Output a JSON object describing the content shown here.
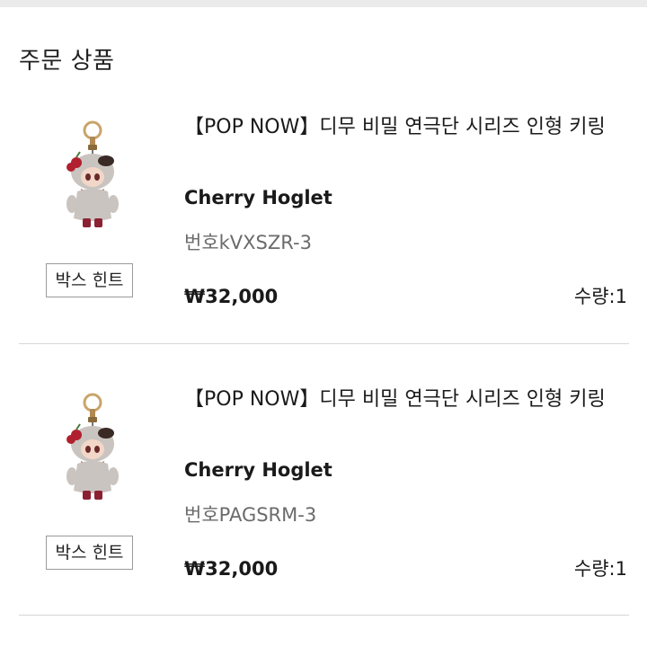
{
  "order": {
    "section_title": "주문 상품",
    "items": [
      {
        "title": "【POP NOW】디무 비밀 연극단 시리즈 인형 키링",
        "option": "Cherry Hoglet",
        "code": "번호kVXSZR-3",
        "price": "₩32,000",
        "quantity": "수량:1",
        "box_hint_label": "박스 힌트",
        "thumbnail_icon": "keychain-doll-icon"
      },
      {
        "title": "【POP NOW】디무 비밀 연극단 시리즈 인형 키링",
        "option": "Cherry Hoglet",
        "code": "번호PAGSRM-3",
        "price": "₩32,000",
        "quantity": "수량:1",
        "box_hint_label": "박스 힌트",
        "thumbnail_icon": "keychain-doll-icon"
      }
    ]
  },
  "colors": {
    "background": "#ebebeb",
    "card": "#ffffff",
    "text": "#1a1a1a",
    "muted": "#6b6b6b",
    "divider": "#d6d6d6",
    "doll_fur": "#c9c4c0",
    "doll_dress": "#8b2131",
    "cherry": "#b0202e",
    "ring": "#c9a46a"
  }
}
